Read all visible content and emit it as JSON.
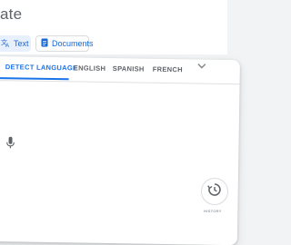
{
  "header": {
    "title_fragment": "ate"
  },
  "modes": {
    "text_label": "Text",
    "documents_label": "Documents",
    "text_icon": "translate-icon",
    "documents_icon": "document-icon"
  },
  "languages": {
    "detect": "DETECT LANGUAGE",
    "english": "ENGLISH",
    "spanish": "SPANISH",
    "french": "FRENCH",
    "more_icon": "chevron-down-icon"
  },
  "input": {
    "mic_icon": "microphone-icon"
  },
  "history": {
    "icon": "history-icon",
    "label": "HISTORY"
  },
  "colors": {
    "accent": "#1a73e8",
    "selected_bg": "#e8f0fe",
    "muted_text": "#5f6368"
  }
}
